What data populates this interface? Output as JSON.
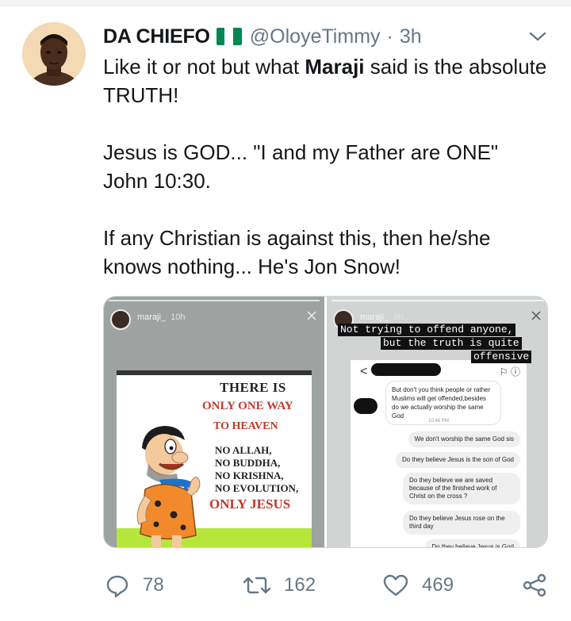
{
  "tweet": {
    "author_name": "DA CHIEFO",
    "handle": "@OloyeTimmy",
    "separator": "·",
    "time": "3h",
    "text": {
      "line1_pre": "Like it or not but what ",
      "line1_bold": "Maraji",
      "line1_post": " said is the absolute TRUTH!",
      "paragraph2": "Jesus is GOD... \"I and my Father are ONE\" John 10:30.",
      "paragraph3": "If any Christian is against this, then he/she knows nothing... He's Jon Snow!"
    }
  },
  "media": {
    "left_story": {
      "username": "maraji_",
      "time": "10h",
      "poster": {
        "line1": "THERE IS",
        "line2": "ONLY ONE WAY",
        "line3": "TO HEAVEN",
        "list": [
          "NO ALLAH,",
          "NO BUDDHA,",
          "NO KRISHNA,",
          "NO EVOLUTION,"
        ],
        "closing": "ONLY JESUS"
      }
    },
    "right_story": {
      "username": "maraji_",
      "time": "8h",
      "caption": [
        "Not trying to offend anyone,",
        "but the truth is quite",
        "offensive"
      ],
      "chat_back": "<",
      "chat_icons": "⚐ ⓘ",
      "incoming_message": "But don't you think people or rather Muslims will get offended,besides do we actually worship the same God",
      "timestamp": "10:46 PM",
      "outgoing_messages": [
        "We don't worship the same God sis",
        "Do they believe Jesus is the son of God",
        "Do they believe we are saved because of the finished work of Christ on the cross ?",
        "Do they believe Jesus rose on the third day",
        "Do they believe Jesus is God"
      ]
    }
  },
  "actions": {
    "replies": "78",
    "retweets": "162",
    "likes": "469"
  },
  "colors": {
    "text": "#14171a",
    "secondary": "#657786",
    "flag_green": "#008751",
    "flag_white": "#ffffff",
    "accent_red": "#c0392b",
    "accent_lime": "#b6e63a"
  },
  "icons": [
    "chevron-down-icon",
    "reply-icon",
    "retweet-icon",
    "like-icon",
    "share-icon",
    "close-icon",
    "nigeria-flag-icon"
  ]
}
